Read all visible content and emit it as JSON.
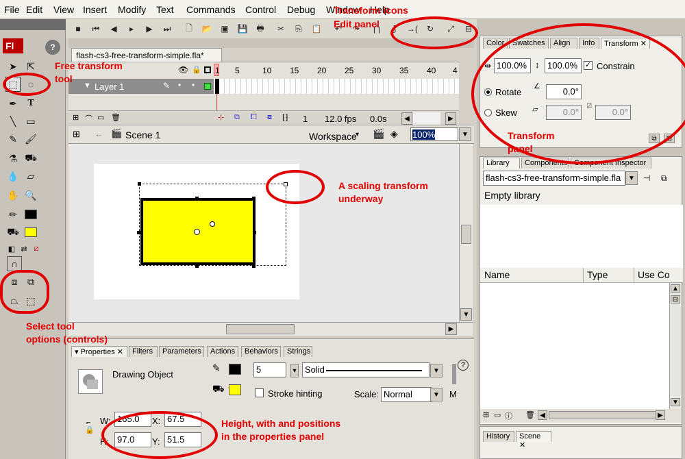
{
  "menu": [
    "File",
    "Edit",
    "View",
    "Insert",
    "Modify",
    "Text",
    "Commands",
    "Control",
    "Debug",
    "Window",
    "Help"
  ],
  "tools_panel": {
    "logo": "Fl",
    "help": "?"
  },
  "document": {
    "tab_label": "flash-cs3-free-transform-simple.fla*"
  },
  "timeline": {
    "frame_numbers": [
      "1",
      "5",
      "10",
      "15",
      "20",
      "25",
      "30",
      "35",
      "40",
      "4"
    ],
    "layer_name": "Layer 1",
    "current_frame": "1",
    "fps": "12.0 fps",
    "time": "0.0s"
  },
  "scene": {
    "name": "Scene 1",
    "workspace_label": "Workspace",
    "zoom": "100%"
  },
  "right_panel": {
    "tabs": [
      "Color",
      "Swatches",
      "Align",
      "Info",
      "Transform"
    ],
    "width_pct": "100.0%",
    "height_pct": "100.0%",
    "constrain_label": "Constrain",
    "rotate_label": "Rotate",
    "rotate_value": "0.0°",
    "skew_label": "Skew",
    "skew_h": "0.0°",
    "skew_v": "0.0°"
  },
  "library": {
    "tabs": [
      "Library",
      "Components",
      "Component Inspector"
    ],
    "file": "flash-cs3-free-transform-simple.fla",
    "empty_text": "Empty library",
    "col_name": "Name",
    "col_type": "Type",
    "col_use": "Use Co"
  },
  "history": {
    "tabs": [
      "History",
      "Scene"
    ]
  },
  "properties": {
    "tabs": [
      "Properties",
      "Filters",
      "Parameters",
      "Actions",
      "Behaviors",
      "Strings"
    ],
    "object_type": "Drawing Object",
    "stroke_size": "5",
    "stroke_style": "Solid",
    "stroke_hinting": "Stroke hinting",
    "scale_label": "Scale:",
    "scale_value": "Normal",
    "miter": "M",
    "w_label": "W:",
    "w_value": "165.0",
    "x_label": "X:",
    "x_value": "67.5",
    "h_label": "H:",
    "h_value": "97.0",
    "y_label": "Y:",
    "y_value": "51.5"
  },
  "annotations": {
    "transform_icons": "Transform icons",
    "edit_panel": "Edit panel",
    "free_transform_1": "Free transform",
    "free_transform_2": "tool",
    "scaling_1": "A scaling transform",
    "scaling_2": "underway",
    "transform_panel_1": "Transform",
    "transform_panel_2": "panel",
    "select_opts_1": "Select tool",
    "select_opts_2": "options (controls)",
    "props_1": "Height, with and positions",
    "props_2": "in the properties panel"
  },
  "colors": {
    "fill": "#ffff00",
    "stroke": "#000000",
    "annotation": "#e00000",
    "logo_bg": "#b80000"
  }
}
